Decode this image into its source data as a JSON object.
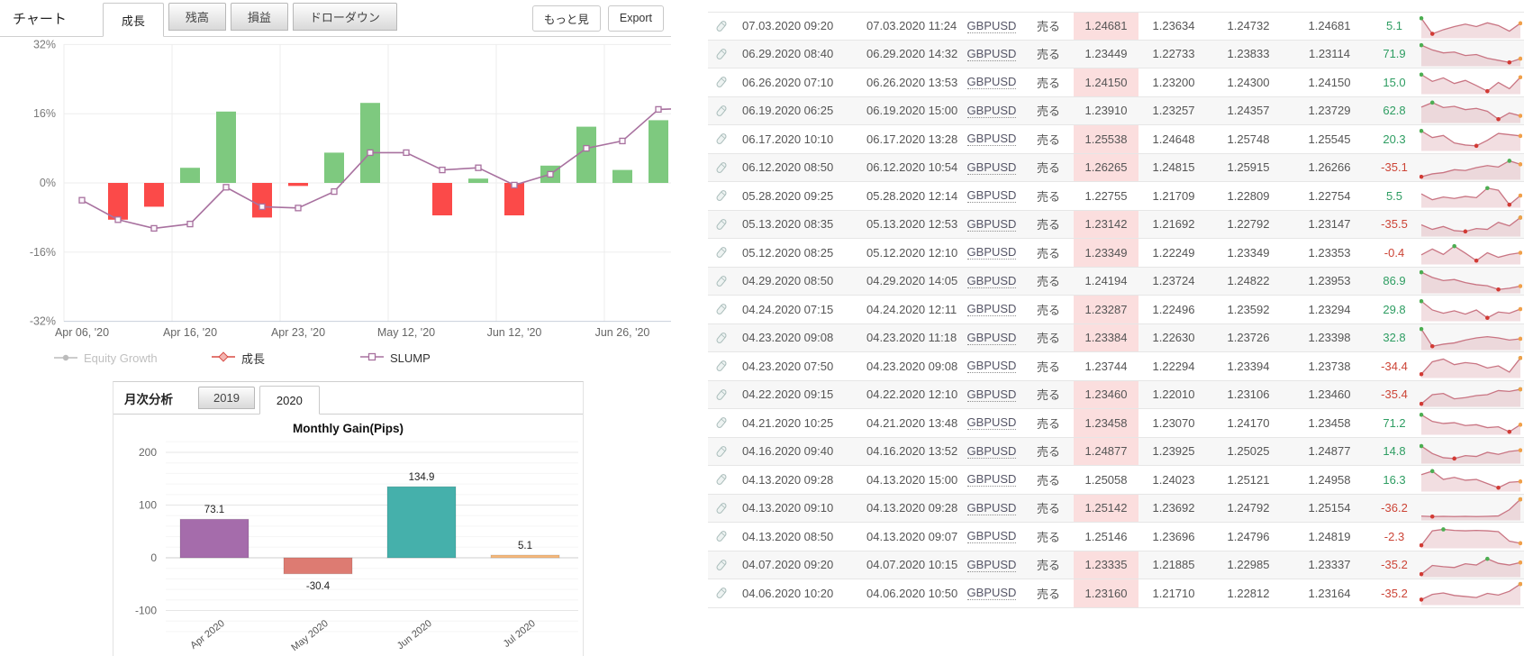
{
  "chart_panel": {
    "label": "チャート",
    "tabs": [
      {
        "label": "成長",
        "active": true
      },
      {
        "label": "残高",
        "active": false
      },
      {
        "label": "損益",
        "active": false
      },
      {
        "label": "ドローダウン",
        "active": false
      }
    ],
    "more_button": "もっと見",
    "export_button": "Export",
    "legend": {
      "equity_growth": "Equity Growth",
      "growth": "成長",
      "slump": "SLUMP"
    }
  },
  "monthly_panel": {
    "label": "月次分析",
    "tabs": [
      {
        "label": "2019",
        "active": false
      },
      {
        "label": "2020",
        "active": true
      }
    ],
    "title": "Monthly Gain(Pips)"
  },
  "chart_data": [
    {
      "name": "growth-chart",
      "type": "bar+line",
      "y_ticks": [
        "32%",
        "16%",
        "0%",
        "-16%",
        "-32%"
      ],
      "y_tick_values": [
        32,
        16,
        0,
        -16,
        -32
      ],
      "ylim": [
        -32,
        32
      ],
      "grid": true,
      "x_ticks": [
        {
          "slot": 0,
          "label": "Apr 06, '20"
        },
        {
          "slot": 3,
          "label": "Apr 16, '20"
        },
        {
          "slot": 6,
          "label": "Apr 23, '20"
        },
        {
          "slot": 9,
          "label": "May 12, '20"
        },
        {
          "slot": 12,
          "label": "Jun 12, '20"
        },
        {
          "slot": 15,
          "label": "Jun 26, '20"
        }
      ],
      "series": [
        {
          "name": "成長",
          "type": "bar",
          "color_pos": "#7ec97f",
          "color_neg": "#fb4a49",
          "values": [
            null,
            -8.5,
            -5.5,
            3.5,
            16.5,
            -8,
            -0.7,
            7,
            18.5,
            null,
            -7.5,
            1,
            -7.5,
            4,
            13,
            3,
            14.5,
            null
          ]
        },
        {
          "name": "SLUMP",
          "type": "line",
          "color": "#a8719f",
          "values": [
            -4,
            -8.5,
            -10.5,
            -9.5,
            -1,
            -5.5,
            -5.8,
            -2,
            7,
            7,
            3,
            3.5,
            -0.5,
            2,
            8,
            9.7,
            17,
            17.3
          ]
        },
        {
          "name": "Equity Growth",
          "type": "line",
          "color": "#bbbbbb",
          "hidden": true,
          "values": []
        }
      ]
    },
    {
      "name": "monthly-gain-chart",
      "type": "bar",
      "title": "Monthly Gain(Pips)",
      "categories": [
        "Apr 2020",
        "May 2020",
        "Jun 2020",
        "Jul 2020"
      ],
      "values": [
        73.1,
        -30.4,
        134.9,
        5.1
      ],
      "value_labels": [
        "73.1",
        "-30.4",
        "134.9",
        "5.1"
      ],
      "bar_colors": [
        "#a56cab",
        "#dd7b72",
        "#45b0ab",
        "#f6b97c"
      ],
      "y_ticks": [
        200,
        100,
        0,
        -100
      ],
      "ylim": [
        -160,
        230
      ],
      "grid": true
    }
  ],
  "trades_table": {
    "symbol": "GBPUSD",
    "action": "売る",
    "positive_color": "#2e9d62",
    "negative_color": "#cc4436",
    "highlight_color": "#fbdede",
    "rows": [
      {
        "open_time": "07.03.2020 09:20",
        "close_time": "07.03.2020 11:24",
        "price1": "1.24681",
        "price1_highlight": true,
        "price2": "1.23634",
        "price3": "1.24732",
        "price4": "1.24681",
        "pips": "5.1",
        "spark": [
          0.9,
          0.15,
          0.35,
          0.5,
          0.62,
          0.5,
          0.68,
          0.55,
          0.28,
          0.66
        ]
      },
      {
        "open_time": "06.29.2020 08:40",
        "close_time": "06.29.2020 14:32",
        "price1": "1.23449",
        "price1_highlight": false,
        "price2": "1.22733",
        "price3": "1.23833",
        "price4": "1.23114",
        "pips": "71.9",
        "spark": [
          0.95,
          0.72,
          0.58,
          0.62,
          0.45,
          0.5,
          0.32,
          0.22,
          0.12,
          0.3
        ]
      },
      {
        "open_time": "06.26.2020 07:10",
        "close_time": "06.26.2020 13:53",
        "price1": "1.24150",
        "price1_highlight": true,
        "price2": "1.23200",
        "price3": "1.24300",
        "price4": "1.24150",
        "pips": "15.0",
        "spark": [
          0.88,
          0.55,
          0.72,
          0.45,
          0.6,
          0.35,
          0.08,
          0.5,
          0.2,
          0.75
        ]
      },
      {
        "open_time": "06.19.2020 06:25",
        "close_time": "06.19.2020 15:00",
        "price1": "1.23910",
        "price1_highlight": false,
        "price2": "1.23257",
        "price3": "1.24357",
        "price4": "1.23729",
        "pips": "62.8",
        "spark": [
          0.7,
          0.92,
          0.68,
          0.74,
          0.58,
          0.64,
          0.5,
          0.12,
          0.42,
          0.28
        ]
      },
      {
        "open_time": "06.17.2020 10:10",
        "close_time": "06.17.2020 13:28",
        "price1": "1.25538",
        "price1_highlight": true,
        "price2": "1.24648",
        "price3": "1.25748",
        "price4": "1.25545",
        "pips": "20.3",
        "spark": [
          0.9,
          0.58,
          0.68,
          0.32,
          0.22,
          0.18,
          0.45,
          0.78,
          0.72,
          0.66
        ]
      },
      {
        "open_time": "06.12.2020 08:50",
        "close_time": "06.12.2020 10:54",
        "price1": "1.26265",
        "price1_highlight": true,
        "price2": "1.24815",
        "price3": "1.25915",
        "price4": "1.26266",
        "pips": "-35.1",
        "spark": [
          0.08,
          0.22,
          0.28,
          0.42,
          0.38,
          0.52,
          0.62,
          0.55,
          0.85,
          0.68
        ]
      },
      {
        "open_time": "05.28.2020 09:25",
        "close_time": "05.28.2020 12:14",
        "price1": "1.22755",
        "price1_highlight": false,
        "price2": "1.21709",
        "price3": "1.22809",
        "price4": "1.22754",
        "pips": "5.5",
        "spark": [
          0.6,
          0.32,
          0.45,
          0.38,
          0.48,
          0.42,
          0.88,
          0.78,
          0.08,
          0.52
        ]
      },
      {
        "open_time": "05.13.2020 08:35",
        "close_time": "05.13.2020 12:53",
        "price1": "1.23142",
        "price1_highlight": true,
        "price2": "1.21692",
        "price3": "1.22792",
        "price4": "1.23147",
        "pips": "-35.5",
        "spark": [
          0.5,
          0.28,
          0.42,
          0.22,
          0.18,
          0.32,
          0.28,
          0.62,
          0.45,
          0.85
        ]
      },
      {
        "open_time": "05.12.2020 08:25",
        "close_time": "05.12.2020 12:10",
        "price1": "1.23349",
        "price1_highlight": true,
        "price2": "1.22249",
        "price3": "1.23349",
        "price4": "1.23353",
        "pips": "-0.4",
        "spark": [
          0.4,
          0.68,
          0.42,
          0.82,
          0.48,
          0.12,
          0.5,
          0.28,
          0.42,
          0.5
        ]
      },
      {
        "open_time": "04.29.2020 08:50",
        "close_time": "04.29.2020 14:05",
        "price1": "1.24194",
        "price1_highlight": false,
        "price2": "1.23724",
        "price3": "1.24822",
        "price4": "1.23953",
        "pips": "86.9",
        "spark": [
          0.95,
          0.7,
          0.55,
          0.6,
          0.45,
          0.35,
          0.3,
          0.12,
          0.18,
          0.28
        ]
      },
      {
        "open_time": "04.24.2020 07:15",
        "close_time": "04.24.2020 12:11",
        "price1": "1.23287",
        "price1_highlight": true,
        "price2": "1.22496",
        "price3": "1.23592",
        "price4": "1.23294",
        "pips": "29.8",
        "spark": [
          0.9,
          0.48,
          0.32,
          0.44,
          0.28,
          0.48,
          0.1,
          0.38,
          0.32,
          0.52
        ]
      },
      {
        "open_time": "04.23.2020 09:08",
        "close_time": "04.23.2020 11:18",
        "price1": "1.23384",
        "price1_highlight": true,
        "price2": "1.22630",
        "price3": "1.23726",
        "price4": "1.23398",
        "pips": "32.8",
        "spark": [
          0.95,
          0.12,
          0.22,
          0.28,
          0.42,
          0.52,
          0.58,
          0.52,
          0.42,
          0.48
        ]
      },
      {
        "open_time": "04.23.2020 07:50",
        "close_time": "04.23.2020 09:08",
        "price1": "1.23744",
        "price1_highlight": false,
        "price2": "1.22294",
        "price3": "1.23394",
        "price4": "1.23738",
        "pips": "-34.4",
        "spark": [
          0.12,
          0.72,
          0.85,
          0.58,
          0.68,
          0.62,
          0.42,
          0.52,
          0.22,
          0.9
        ]
      },
      {
        "open_time": "04.22.2020 09:15",
        "close_time": "04.22.2020 12:10",
        "price1": "1.23460",
        "price1_highlight": true,
        "price2": "1.22010",
        "price3": "1.23106",
        "price4": "1.23460",
        "pips": "-35.4",
        "spark": [
          0.08,
          0.52,
          0.58,
          0.32,
          0.38,
          0.48,
          0.52,
          0.72,
          0.68,
          0.78
        ]
      },
      {
        "open_time": "04.21.2020 10:25",
        "close_time": "04.21.2020 13:48",
        "price1": "1.23458",
        "price1_highlight": true,
        "price2": "1.23070",
        "price3": "1.24170",
        "price4": "1.23458",
        "pips": "71.2",
        "spark": [
          0.9,
          0.58,
          0.48,
          0.52,
          0.38,
          0.42,
          0.28,
          0.32,
          0.08,
          0.42
        ]
      },
      {
        "open_time": "04.16.2020 09:40",
        "close_time": "04.16.2020 13:52",
        "price1": "1.24877",
        "price1_highlight": true,
        "price2": "1.23925",
        "price3": "1.25025",
        "price4": "1.24877",
        "pips": "14.8",
        "spark": [
          0.78,
          0.42,
          0.22,
          0.18,
          0.32,
          0.28,
          0.48,
          0.38,
          0.52,
          0.58
        ]
      },
      {
        "open_time": "04.13.2020 09:28",
        "close_time": "04.13.2020 15:00",
        "price1": "1.25058",
        "price1_highlight": false,
        "price2": "1.24023",
        "price3": "1.25121",
        "price4": "1.24958",
        "pips": "16.3",
        "spark": [
          0.75,
          0.92,
          0.52,
          0.62,
          0.48,
          0.52,
          0.32,
          0.12,
          0.38,
          0.42
        ]
      },
      {
        "open_time": "04.13.2020 09:10",
        "close_time": "04.13.2020 09:28",
        "price1": "1.25142",
        "price1_highlight": true,
        "price2": "1.23692",
        "price3": "1.24792",
        "price4": "1.25154",
        "pips": "-36.2",
        "spark": [
          0.14,
          0.12,
          0.13,
          0.12,
          0.13,
          0.12,
          0.13,
          0.15,
          0.45,
          0.95
        ]
      },
      {
        "open_time": "04.13.2020 08:50",
        "close_time": "04.13.2020 09:07",
        "price1": "1.25146",
        "price1_highlight": false,
        "price2": "1.23696",
        "price3": "1.24796",
        "price4": "1.24819",
        "pips": "-2.3",
        "spark": [
          0.08,
          0.78,
          0.85,
          0.8,
          0.78,
          0.8,
          0.78,
          0.74,
          0.28,
          0.18
        ]
      },
      {
        "open_time": "04.07.2020 09:20",
        "close_time": "04.07.2020 10:15",
        "price1": "1.23335",
        "price1_highlight": true,
        "price2": "1.21885",
        "price3": "1.22985",
        "price4": "1.23337",
        "pips": "-35.2",
        "spark": [
          0.08,
          0.5,
          0.44,
          0.4,
          0.58,
          0.52,
          0.82,
          0.6,
          0.52,
          0.64
        ]
      },
      {
        "open_time": "04.06.2020 10:20",
        "close_time": "04.06.2020 10:50",
        "price1": "1.23160",
        "price1_highlight": true,
        "price2": "1.21710",
        "price3": "1.22812",
        "price4": "1.23164",
        "pips": "-35.2",
        "spark": [
          0.2,
          0.45,
          0.52,
          0.4,
          0.35,
          0.3,
          0.5,
          0.42,
          0.6,
          0.95
        ]
      }
    ]
  }
}
